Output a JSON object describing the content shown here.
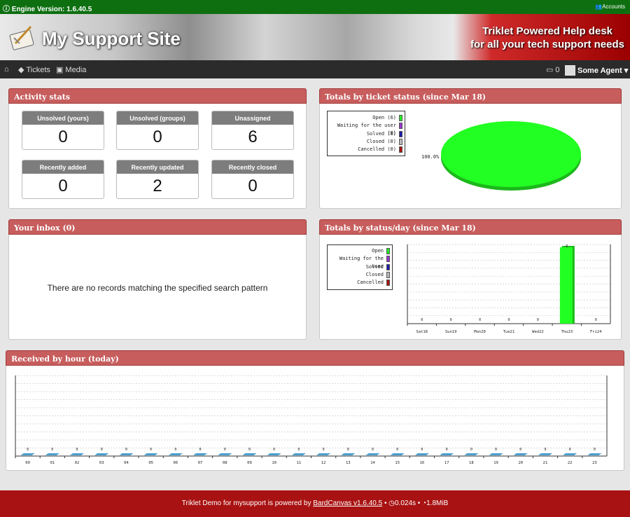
{
  "topbar": {
    "engine_version": "Engine Version: 1.6.40.5",
    "accounts_label": "Accounts"
  },
  "banner": {
    "site_title": "My Support Site",
    "tagline_1": "Triklet Powered Help desk",
    "tagline_2": "for all your tech support needs"
  },
  "nav": {
    "tickets_label": "Tickets",
    "media_label": "Media",
    "notification_count": "0",
    "agent_name": "Some Agent"
  },
  "activity": {
    "title": "Activity stats",
    "stats": [
      {
        "label": "Unsolved (yours)",
        "value": "0"
      },
      {
        "label": "Unsolved (groups)",
        "value": "0"
      },
      {
        "label": "Unassigned",
        "value": "6"
      },
      {
        "label": "Recently added",
        "value": "0"
      },
      {
        "label": "Recently updated",
        "value": "2"
      },
      {
        "label": "Recently closed",
        "value": "0"
      }
    ]
  },
  "status_totals": {
    "title": "Totals by ticket status (since Mar 18)",
    "legend": [
      "Open (6)",
      "Waiting for the user (0)",
      "Solved (0)",
      "Closed (0)",
      "Cancelled (0)"
    ],
    "colors": [
      "#22ee22",
      "#9933cc",
      "#1a1aaa",
      "#bbbbbb",
      "#aa1111"
    ]
  },
  "inbox": {
    "title": "Your inbox (0)",
    "empty_message": "There are no records matching the specified search pattern"
  },
  "status_day": {
    "title": "Totals by status/day (since Mar 18)",
    "legend": [
      "Open",
      "Waiting for the user",
      "Solved",
      "Closed",
      "Cancelled"
    ]
  },
  "hourly": {
    "title": "Received by hour (today)"
  },
  "chart_data": [
    {
      "type": "pie",
      "categories": [
        "Open (6)",
        "Waiting for the user (0)",
        "Solved (0)",
        "Closed (0)",
        "Cancelled (0)"
      ],
      "values": [
        6,
        0,
        0,
        0,
        0
      ],
      "data_label": "100.0%"
    },
    {
      "type": "bar",
      "categories": [
        "Sat18",
        "Sun19",
        "Mon20",
        "Tue21",
        "Wed22",
        "Thu23",
        "Fri24"
      ],
      "series": [
        {
          "name": "Open",
          "values": [
            0,
            0,
            0,
            0,
            0,
            6,
            0
          ]
        }
      ],
      "data_labels": [
        "0",
        "0",
        "0",
        "0",
        "0",
        "6",
        "0"
      ]
    },
    {
      "type": "bar",
      "categories": [
        "00",
        "01",
        "02",
        "03",
        "04",
        "05",
        "06",
        "07",
        "08",
        "09",
        "10",
        "11",
        "12",
        "13",
        "14",
        "15",
        "16",
        "17",
        "18",
        "19",
        "20",
        "21",
        "22",
        "23"
      ],
      "values": [
        0,
        0,
        0,
        0,
        0,
        0,
        0,
        0,
        0,
        0,
        0,
        0,
        0,
        0,
        0,
        0,
        0,
        0,
        0,
        0,
        0,
        0,
        0,
        0
      ],
      "data_labels": [
        "0",
        "0",
        "0",
        "0",
        "0",
        "0",
        "0",
        "0",
        "0",
        "0",
        "0",
        "0",
        "0",
        "0",
        "0",
        "0",
        "0",
        "0",
        "0",
        "0",
        "0",
        "0",
        "0",
        "0"
      ]
    }
  ],
  "footer": {
    "prefix": "Triklet Demo for mysupport is powered by",
    "link": "BardCanvas v1.6.40.5",
    "time": "0.024s",
    "memory": "1.8MiB"
  }
}
